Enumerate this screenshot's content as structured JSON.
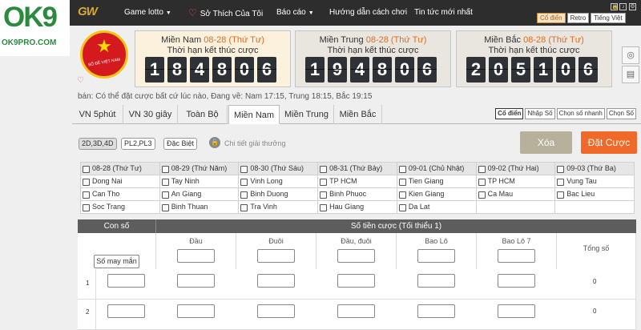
{
  "logo": {
    "text": "OK9",
    "url": "OK9PRO.COM"
  },
  "topbar": {
    "brand": "GW",
    "nav": [
      {
        "label": "Game lotto",
        "caret": true
      },
      {
        "label": "Sở Thích Của Tôi",
        "caret": false
      },
      {
        "label": "Báo cáo",
        "caret": true
      },
      {
        "label": "Hướng dẫn cách chơi",
        "caret": false
      },
      {
        "label": "Tin tức mới nhất",
        "caret": false
      }
    ],
    "style_buttons": [
      "Cổ điển",
      "Retro",
      "Tiếng Việt"
    ],
    "active_style": "Cổ điển"
  },
  "badge": {
    "text": "SỐ ĐỀ VIỆT NAM"
  },
  "regions": [
    {
      "name": "Miền Nam",
      "date": "08-28 (Thứ Tư)",
      "label": "Thời hạn kết thúc cược",
      "digits": [
        "1",
        "8",
        "4",
        "8",
        "0",
        "6"
      ],
      "active": true
    },
    {
      "name": "Miền Trung",
      "date": "08-28 (Thứ Tư)",
      "label": "Thời hạn kết thúc cược",
      "digits": [
        "1",
        "9",
        "4",
        "8",
        "0",
        "6"
      ],
      "active": false
    },
    {
      "name": "Miền Bắc",
      "date": "08-28 (Thứ Tư)",
      "label": "Thời hạn kết thúc cược",
      "digits": [
        "2",
        "0",
        "5",
        "1",
        "0",
        "6"
      ],
      "active": false
    }
  ],
  "ticker": "bán: Có thể đặt cược bất cứ lúc nào,   Đang về: Nam 17:15, Trung 18:15, Bắc 19:15",
  "tabs": [
    "VN 5phút",
    "VN 30 giây",
    "Toàn Bộ",
    "Miền Nam",
    "Miền Trung",
    "Miền Bắc"
  ],
  "active_tab": "Miền Nam",
  "modes": [
    "Cổ điển",
    "Nhập Số",
    "Chọn số nhanh",
    "Chọn Số"
  ],
  "active_mode": "Cổ điển",
  "bet_types": [
    "2D,3D,4D",
    "PL2,PL3",
    "Đặc Biệt"
  ],
  "active_bet_type": "2D,3D,4D",
  "prize_link": "Chi tiết giải thưởng",
  "clear_btn": "Xóa",
  "place_btn": "Đặt Cược",
  "days": [
    {
      "day": "08-28 (Thứ Tư)",
      "stations": [
        "Dong Nai",
        "Can Tho",
        "Soc Trang"
      ]
    },
    {
      "day": "08-29 (Thứ Năm)",
      "stations": [
        "Tay Ninh",
        "An Giang",
        "Binh Thuan"
      ]
    },
    {
      "day": "08-30 (Thứ Sáu)",
      "stations": [
        "Vinh Long",
        "Binh Duong",
        "Tra Vinh"
      ]
    },
    {
      "day": "08-31 (Thứ Bảy)",
      "stations": [
        "TP HCM",
        "Binh Phuoc",
        "Hau Giang"
      ]
    },
    {
      "day": "09-01 (Chủ Nhật)",
      "stations": [
        "Tien Giang",
        "Kien Giang",
        "Da Lat"
      ]
    },
    {
      "day": "09-02 (Thứ Hai)",
      "stations": [
        "TP HCM",
        "Ca Mau",
        ""
      ]
    },
    {
      "day": "09-03 (Thứ Ba)",
      "stations": [
        "Vung Tau",
        "Bac Lieu",
        ""
      ]
    }
  ],
  "bet_table": {
    "header_left": "Con số",
    "header_amount": "Số tiền cược (Tối thiểu 1)",
    "random_btn": "Số may mắn",
    "columns": [
      "Đầu",
      "Đuôi",
      "Đầu, đuôi",
      "Bao Lô",
      "Bao Lô 7"
    ],
    "total_label": "Tổng số",
    "rows": [
      {
        "num": "1",
        "total": "0"
      },
      {
        "num": "2",
        "total": "0"
      }
    ]
  }
}
